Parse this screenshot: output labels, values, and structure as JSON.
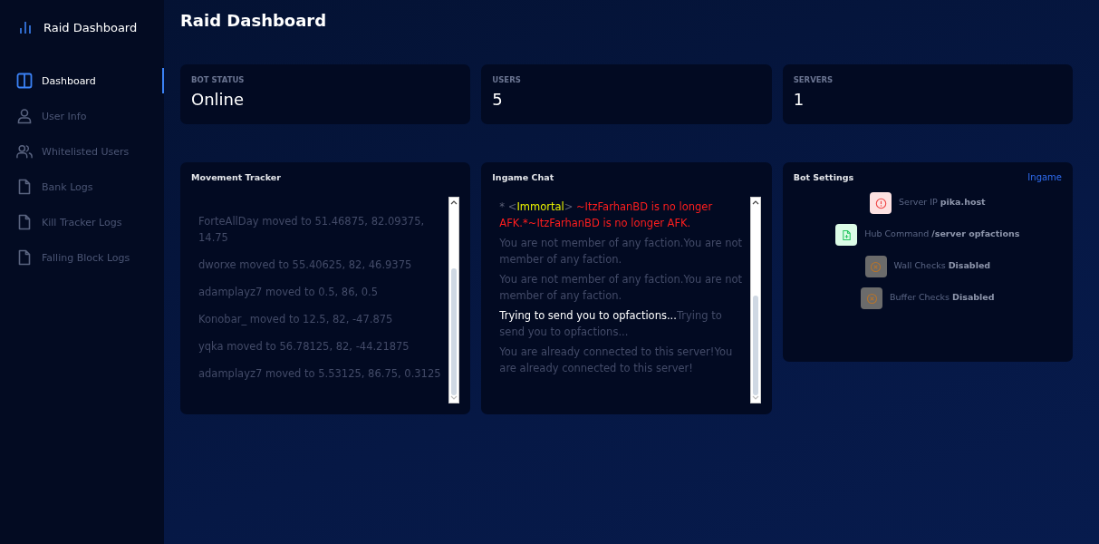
{
  "sidebar": {
    "brand": "Raid Dashboard",
    "items": [
      {
        "label": "Dashboard",
        "kind": "columns",
        "selected": true
      },
      {
        "label": "User Info",
        "kind": "user",
        "selected": false
      },
      {
        "label": "Whitelisted Users",
        "kind": "users",
        "selected": false
      },
      {
        "label": "Bank Logs",
        "kind": "file",
        "selected": false
      },
      {
        "label": "Kill Tracker Logs",
        "kind": "file",
        "selected": false
      },
      {
        "label": "Falling Block Logs",
        "kind": "file",
        "selected": false
      }
    ]
  },
  "page_title": "Raid Dashboard",
  "stats": [
    {
      "label": "BOT STATUS",
      "value": "Online"
    },
    {
      "label": "USERS",
      "value": "5"
    },
    {
      "label": "SERVERS",
      "value": "1"
    }
  ],
  "movement_tracker": {
    "title": "Movement Tracker",
    "entries": [
      "ForteAllDay moved to 51.46875, 82.09375, 14.75",
      "dworxe moved to 55.40625, 82, 46.9375",
      "adamplayz7 moved to 0.5, 86, 0.5",
      "Konobar_ moved to 12.5, 82, -47.875",
      "yqka moved to 56.78125, 82, -44.21875",
      "adamplayz7 moved to 5.53125, 86.75, 0.3125"
    ]
  },
  "ingame_chat": {
    "title": "Ingame Chat",
    "messages": [
      {
        "segments": [
          {
            "text": "* <",
            "color": "#5a5f75"
          },
          {
            "text": "Immortal",
            "color": "#e8f000"
          },
          {
            "text": "> ",
            "color": "#5a5f75"
          },
          {
            "text": "~ItzFarhanBD is no longer AFK.*~ItzFarhanBD is no longer AFK.",
            "color": "#ff1e1e"
          }
        ]
      },
      {
        "segments": [
          {
            "text": "You are not member of any faction.You are not member of any faction.",
            "color": "#434b68"
          }
        ]
      },
      {
        "segments": [
          {
            "text": "You are not member of any faction.You are not member of any faction.",
            "color": "#434b68"
          }
        ]
      },
      {
        "segments": [
          {
            "text": "Trying to send you to opfactions...",
            "color": "#ffffff"
          },
          {
            "text": "Trying to send you to opfactions...",
            "color": "#434b68"
          }
        ]
      },
      {
        "segments": [
          {
            "text": "You are already connected to this server!You are already connected to this server!",
            "color": "#434b68"
          }
        ]
      }
    ]
  },
  "bot_settings": {
    "title": "Bot Settings",
    "mode": "Ingame",
    "items": [
      {
        "kind": "alert",
        "text": "Server IP **pika.host**"
      },
      {
        "kind": "file",
        "text": "Hub Command **/server opfactions**"
      },
      {
        "kind": "disabled",
        "text": "Wall Checks **Disabled**"
      },
      {
        "kind": "disabled",
        "text": "Buffer Checks **Disabled**"
      }
    ]
  }
}
